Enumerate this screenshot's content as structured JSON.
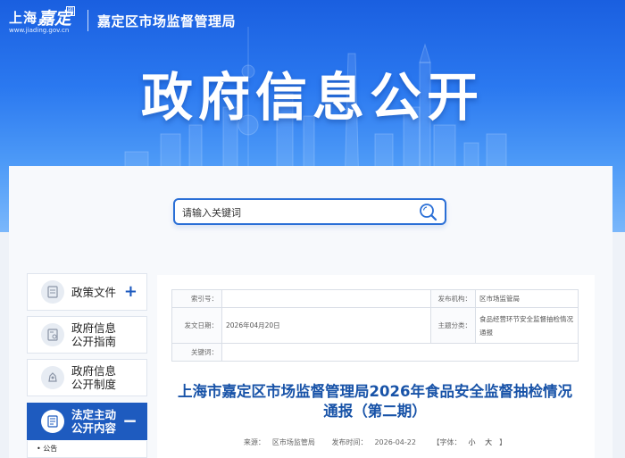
{
  "header": {
    "logo_shanghai": "上海",
    "logo_jiading": "嘉定",
    "logo_seal": "图",
    "logo_url": "www.jiading.gov.cn",
    "org_name": "嘉定区市场监督管理局",
    "hero_title": "政府信息公开"
  },
  "search": {
    "placeholder": "请输入关键词",
    "button_icon": "search-icon"
  },
  "sidebar": {
    "items": [
      {
        "label_1": "政策文件",
        "label_2": "",
        "icon": "document-icon",
        "toggle": "+"
      },
      {
        "label_1": "政府信息",
        "label_2": "公开指南",
        "icon": "guide-icon"
      },
      {
        "label_1": "政府信息",
        "label_2": "公开制度",
        "icon": "rules-icon"
      },
      {
        "label_1": "法定主动",
        "label_2": "公开内容",
        "icon": "list-icon",
        "toggle": "−",
        "active": true
      }
    ],
    "sub_items": [
      "• 公告"
    ]
  },
  "meta": {
    "index_label": "索引号：",
    "index_value": "",
    "publisher_label": "发布机构：",
    "publisher_value": "区市场监管局",
    "date_label": "发文日期：",
    "date_value": "2026年04月20日",
    "category_label": "主题分类：",
    "category_value": "食品经营环节安全监督抽检情况通报",
    "keywords_label": "关键词：",
    "keywords_value": ""
  },
  "article": {
    "title": "上海市嘉定区市场监督管理局2026年食品安全监督抽检情况通报（第二期）",
    "source_label": "来源：",
    "source_value": "区市场监管局",
    "publish_label": "发布时间：",
    "publish_value": "2026-04-22",
    "font_label": "【字体：",
    "font_small": "小",
    "font_large": "大",
    "font_close": "】"
  },
  "colors": {
    "brand_blue": "#1e5bbf",
    "title_blue": "#1853a8",
    "banner_top": "#1a5fe0"
  }
}
